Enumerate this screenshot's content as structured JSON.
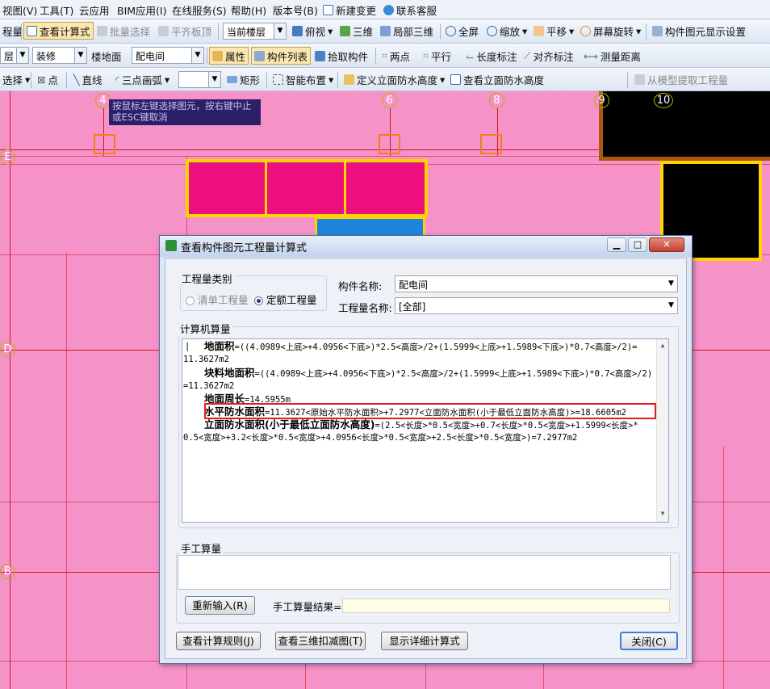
{
  "menubar": [
    "视图(V)",
    "工具(T)",
    "云应用",
    "BIM应用(I)",
    "在线服务(S)",
    "帮助(H)",
    "版本号(B)",
    "新建变更",
    "联系客服"
  ],
  "toolbar1": {
    "items": [
      "程量",
      "查看计算式",
      "批量选择",
      "平齐板顶",
      "俯视",
      "三维",
      "局部三维",
      "全屏",
      "缩放",
      "平移",
      "屏幕旋转",
      "构件图元显示设置"
    ],
    "floor_combo": "当前楼层"
  },
  "toolbar2": {
    "combo_left": "层",
    "combo_category": "装修",
    "combo_type_label": "楼地面",
    "combo_component": "配电间",
    "items": [
      "属性",
      "构件列表",
      "拾取构件",
      "两点",
      "平行",
      "长度标注",
      "对齐标注",
      "测量距离"
    ]
  },
  "toolbar3": {
    "items": [
      "选择",
      "点",
      "直线",
      "三点画弧",
      "矩形",
      "智能布置",
      "定义立面防水高度",
      "查看立面防水高度",
      "从模型提取工程量"
    ]
  },
  "canvas": {
    "axes_top": [
      "4",
      "6",
      "8",
      "9",
      "10"
    ],
    "axes_left": [
      "E",
      "D",
      "B"
    ],
    "tooltip": [
      "按鼠标左键选择图元，按右键中止",
      "或ESC键取消"
    ]
  },
  "dialog": {
    "title": "查看构件图元工程量计算式",
    "quantity_type_label": "工程量类别",
    "radio_bill": "清单工程量",
    "radio_quota": "定额工程量",
    "component_name_label": "构件名称:",
    "component_name_value": "配电间",
    "quantity_name_label": "工程量名称:",
    "quantity_name_value": "[全部]",
    "computer_label": "计算机算量",
    "formula": [
      {
        "name": "地面积",
        "expr": "=((4.0989<上底>+4.0956<下底>)*2.5<高度>/2+(1.5999<上底>+1.5989<下底>)*0.7<高度>/2)="
      },
      {
        "name": "",
        "expr": "11.3627m2"
      },
      {
        "name": "块料地面积",
        "expr": "=((4.0989<上底>+4.0956<下底>)*2.5<高度>/2+(1.5999<上底>+1.5989<下底>)*0.7<高度>/2)"
      },
      {
        "name": "",
        "expr": "=11.3627m2"
      },
      {
        "name": "地面周长",
        "expr": "=14.5955m"
      },
      {
        "name": "水平防水面积",
        "expr": "=11.3627<原始水平防水面积>+7.2977<立面防水面积(小于最低立面防水高度)>=18.6605m2"
      },
      {
        "name": "立面防水面积(小于最低立面防水高度)",
        "expr": "=(2.5<长度>*0.5<宽度>+0.7<长度>*0.5<宽度>+1.5999<长度>*"
      },
      {
        "name": "",
        "expr": "0.5<宽度>+3.2<长度>*0.5<宽度>+4.0956<长度>*0.5<宽度>+2.5<长度>*0.5<宽度>)=7.2977m2"
      }
    ],
    "manual_label": "手工算量",
    "reenter_button": "重新输入(R)",
    "manual_result_label": "手工算量结果=",
    "btn_rules": "查看计算规则(J)",
    "btn_3d": "查看三维扣减图(T)",
    "btn_detail": "显示详细计算式",
    "btn_close": "关闭(C)",
    "highlight_color": "#e0201c"
  }
}
